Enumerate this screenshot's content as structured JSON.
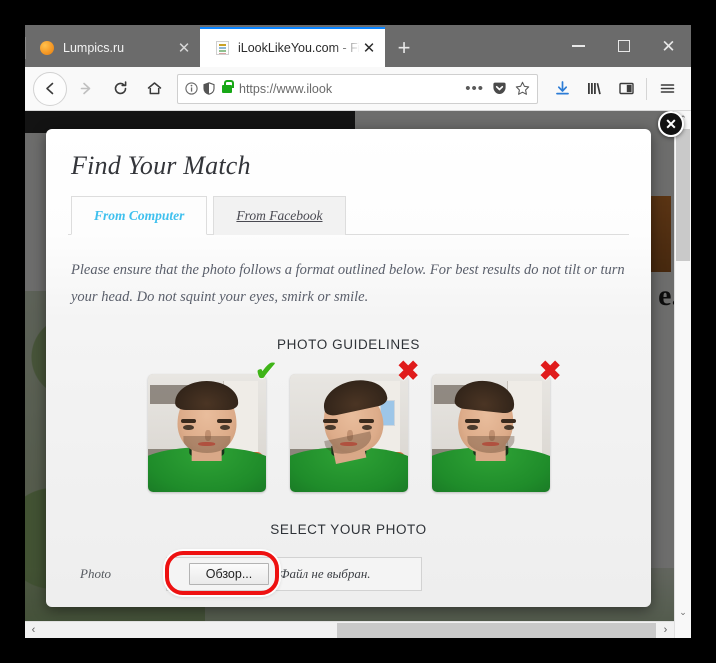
{
  "browser": {
    "tabs": [
      {
        "title": "Lumpics.ru",
        "favicon": "orange-circle-icon",
        "active": false,
        "close_label": "✕"
      },
      {
        "title": "iLookLikeYou.com - Find m",
        "favicon": "document-icon",
        "active": true,
        "close_label": "✕"
      }
    ],
    "new_tab_label": "+",
    "window_controls": {
      "minimize": "–",
      "maximize": "□",
      "close": "✕"
    },
    "nav": {
      "back": "←",
      "forward": "→",
      "reload": "↻",
      "home": "⌂"
    },
    "url": "https://www.ilook",
    "url_icons": [
      "info-icon",
      "shield-icon",
      "padlock-icon"
    ],
    "url_actions": {
      "page_actions": "•••",
      "pocket": "pocket-icon",
      "bookmark": "star-icon"
    },
    "toolbar_icons": [
      "download-icon",
      "library-icon",
      "sidebar-icon",
      "menu-icon"
    ]
  },
  "site": {
    "background_text": "e."
  },
  "modal": {
    "close_label": "✕",
    "title": "Find Your Match",
    "tabs": [
      {
        "label": "From Computer",
        "active": true
      },
      {
        "label": "From Facebook",
        "active": false
      }
    ],
    "instructions": "Please ensure that the photo follows a format outlined below. For best results do not tilt or turn your head. Do not squint your eyes, smirk or smile.",
    "guidelines_heading": "PHOTO GUIDELINES",
    "guideline_photos": [
      {
        "mark": "✔",
        "status": "good",
        "alt": "frontal face photo, correct"
      },
      {
        "mark": "✖",
        "status": "bad",
        "alt": "tilted head photo, incorrect"
      },
      {
        "mark": "✖",
        "status": "bad",
        "alt": "turned head photo, incorrect"
      }
    ],
    "select_heading": "SELECT YOUR PHOTO",
    "file_field": {
      "label": "Photo",
      "button_label": "Обзор...",
      "status_text": "Файл не выбран."
    }
  },
  "scrollbars": {
    "vertical": {
      "up": "⌃",
      "down": "⌄"
    },
    "horizontal": {
      "left": "‹",
      "right": "›"
    }
  },
  "colors": {
    "accent_tab": "#3fc0ee",
    "active_tab_border": "#0a84ff",
    "good_mark": "#3fb418",
    "bad_mark": "#e01b1b",
    "highlight_annotation": "#ee1111",
    "lock_green": "#18a817"
  }
}
